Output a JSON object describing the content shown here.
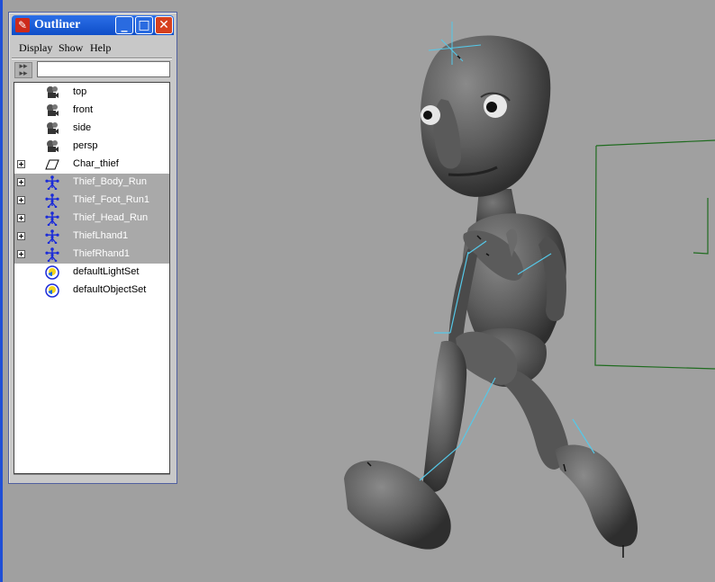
{
  "window": {
    "title": "Outliner",
    "controls": {
      "minimize": "_",
      "maximize": "□",
      "close": "✕"
    }
  },
  "menu": [
    "Display",
    "Show",
    "Help"
  ],
  "filter": {
    "value": ""
  },
  "outliner": {
    "items": [
      {
        "label": "top",
        "icon": "camera-icon",
        "expandable": false,
        "selected": false
      },
      {
        "label": "front",
        "icon": "camera-icon",
        "expandable": false,
        "selected": false
      },
      {
        "label": "side",
        "icon": "camera-icon",
        "expandable": false,
        "selected": false
      },
      {
        "label": "persp",
        "icon": "camera-icon",
        "expandable": false,
        "selected": false
      },
      {
        "label": "Char_thief",
        "icon": "mesh-icon",
        "expandable": true,
        "selected": false
      },
      {
        "label": "Thief_Body_Run",
        "icon": "joint-icon",
        "expandable": true,
        "selected": true
      },
      {
        "label": "Thief_Foot_Run1",
        "icon": "joint-icon",
        "expandable": true,
        "selected": true
      },
      {
        "label": "Thief_Head_Run",
        "icon": "joint-icon",
        "expandable": true,
        "selected": true
      },
      {
        "label": "ThiefLhand1",
        "icon": "joint-icon",
        "expandable": true,
        "selected": true
      },
      {
        "label": "ThiefRhand1",
        "icon": "joint-icon",
        "expandable": true,
        "selected": true
      },
      {
        "label": "defaultLightSet",
        "icon": "set-icon",
        "expandable": false,
        "selected": false
      },
      {
        "label": "defaultObjectSet",
        "icon": "set-icon",
        "expandable": false,
        "selected": false
      }
    ]
  },
  "colors": {
    "viewport": "#a0a0a0",
    "selection": "#a9a9a9",
    "title": "#0e4ec8",
    "joint": "#1b2bd9",
    "bone": "#55c8e8",
    "plane": "#1f6b1f"
  }
}
